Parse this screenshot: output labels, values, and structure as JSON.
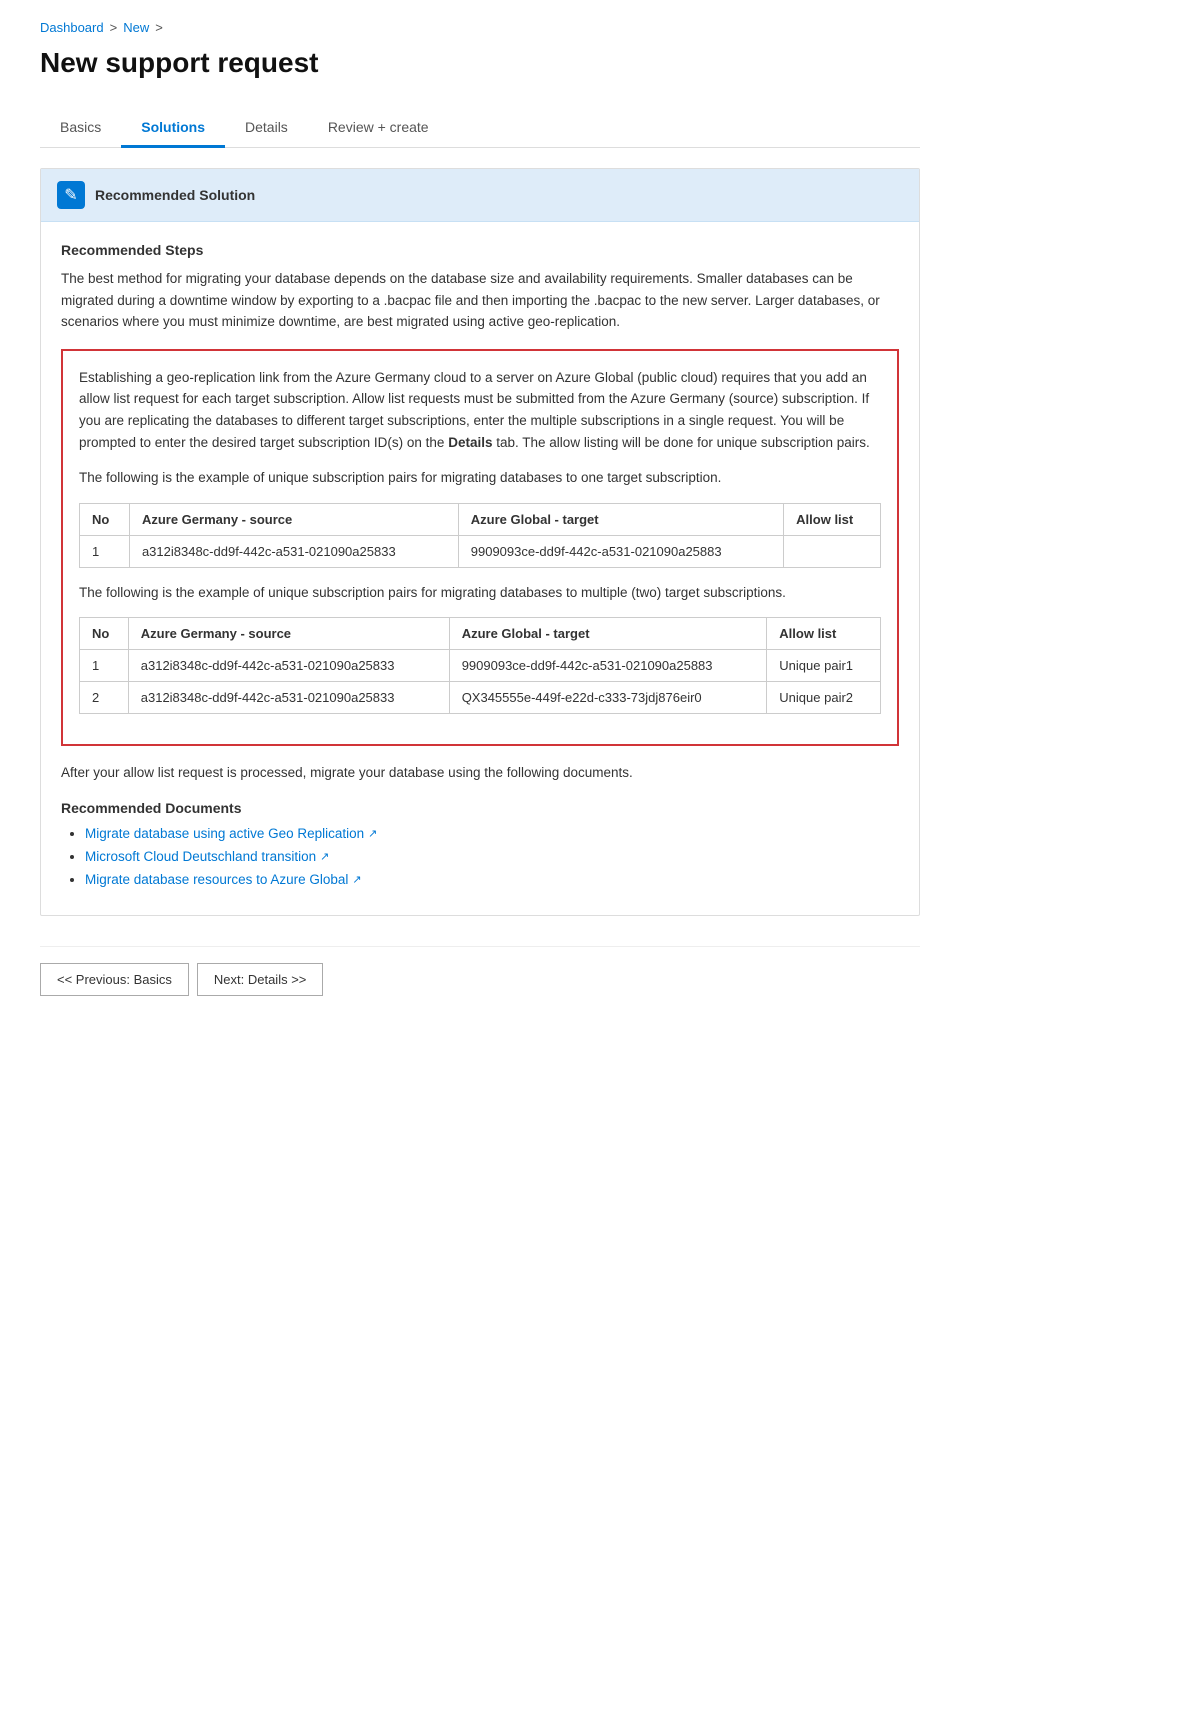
{
  "breadcrumb": {
    "dashboard": "Dashboard",
    "new": "New",
    "separator": ">"
  },
  "page": {
    "title": "New support request"
  },
  "tabs": [
    {
      "id": "basics",
      "label": "Basics",
      "active": false
    },
    {
      "id": "solutions",
      "label": "Solutions",
      "active": true
    },
    {
      "id": "details",
      "label": "Details",
      "active": false
    },
    {
      "id": "review-create",
      "label": "Review + create",
      "active": false
    }
  ],
  "recommended": {
    "header_title": "Recommended Solution",
    "icon": "✎",
    "steps_title": "Recommended Steps",
    "intro_text": "The best method for migrating your database depends on the database size and availability requirements. Smaller databases can be migrated during a downtime window by exporting to a .bacpac file and then importing the .bacpac to the new server. Larger databases, or scenarios where you must minimize downtime, are best migrated using active geo-replication.",
    "geo_replication_text": "Establishing a geo-replication link from the Azure Germany cloud to a server on Azure Global (public cloud) requires that you add an allow list request for each target subscription. Allow list requests must be submitted from the Azure Germany (source) subscription. If you are replicating the databases to different target subscriptions, enter the multiple subscriptions in a single request. You will be prompted to enter the desired target subscription ID(s) on the",
    "geo_bold": "Details",
    "geo_replication_text2": "tab. The allow listing will be done for unique subscription pairs.",
    "single_target_text": "The following is the example of unique subscription pairs for migrating databases to one target subscription.",
    "table1": {
      "headers": [
        "No",
        "Azure Germany - source",
        "Azure Global - target",
        "Allow list"
      ],
      "rows": [
        {
          "no": "1",
          "source": "a312i8348c-dd9f-442c-a531-021090a25833",
          "target": "9909093ce-dd9f-442c-a531-021090a25883",
          "allow": ""
        }
      ]
    },
    "multi_target_text": "The following is the example of unique subscription pairs for migrating databases to multiple (two) target subscriptions.",
    "table2": {
      "headers": [
        "No",
        "Azure Germany - source",
        "Azure Global - target",
        "Allow list"
      ],
      "rows": [
        {
          "no": "1",
          "source": "a312i8348c-dd9f-442c-a531-021090a25833",
          "target": "9909093ce-dd9f-442c-a531-021090a25883",
          "allow": "Unique pair1"
        },
        {
          "no": "2",
          "source": "a312i8348c-dd9f-442c-a531-021090a25833",
          "target": "QX345555e-449f-e22d-c333-73jdj876eir0",
          "allow": "Unique pair2"
        }
      ]
    },
    "after_text": "After your allow list request is processed, migrate your database using the following documents.",
    "docs_title": "Recommended Documents",
    "docs": [
      {
        "id": "doc1",
        "label": "Migrate database using active Geo Replication",
        "href": "#"
      },
      {
        "id": "doc2",
        "label": "Microsoft Cloud Deutschland transition",
        "href": "#"
      },
      {
        "id": "doc3",
        "label": "Migrate database resources to Azure Global",
        "href": "#"
      }
    ]
  },
  "buttons": {
    "previous": "<< Previous: Basics",
    "next": "Next: Details >>"
  }
}
